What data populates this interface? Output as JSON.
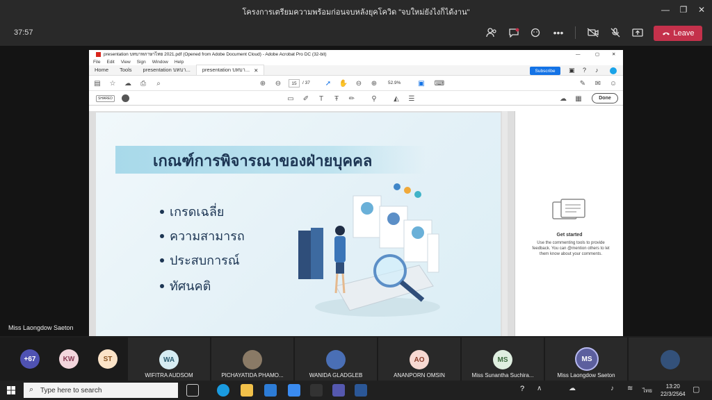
{
  "window": {
    "title": "โครงการเตรียมความพร้อมก่อนจบหลังยุคโควิด \"จบใหม่ยังไงก็ได้งาน\"",
    "minimize": "—",
    "maximize": "❐",
    "close": "✕"
  },
  "call": {
    "timer": "37:57",
    "leave_label": "Leave",
    "presenter_name": "Miss Laongdow Saeton"
  },
  "acrobat": {
    "title": "presentation บทบาทภาษาไทย 2021.pdf (Opened from Adobe Document Cloud) - Adobe Acrobat Pro DC (32-bit)",
    "menu": [
      "File",
      "Edit",
      "View",
      "Sign",
      "Window",
      "Help"
    ],
    "tabs": [
      "Home",
      "Tools",
      "presentation บทบา...",
      "presentation บทบา..."
    ],
    "subscribe_label": "Subscribe",
    "page_current": "15",
    "page_total": "/ 37",
    "zoom": "52.9%",
    "shared_label": "SHARED",
    "done_label": "Done",
    "side_panel": {
      "heading": "Get started",
      "text": "Use the commenting tools to provide feedback. You can @mention others to let them know about your comments."
    }
  },
  "slide": {
    "title": "เกณฑ์การพิจารณาของฝ่ายบุคคล",
    "bullets": [
      "เกรดเฉลี่ย",
      "ความสามารถ",
      "ประสบการณ์",
      "ทัศนคติ"
    ]
  },
  "participants": {
    "overflow": "+67",
    "tiles": [
      {
        "initials": "KW",
        "color": "#f3d6dd",
        "text_color": "#8a3c55"
      },
      {
        "initials": "ST",
        "color": "#fbe3c7",
        "text_color": "#8a5420"
      },
      {
        "initials": "WA",
        "name": "WIFITRA AUDSOM",
        "color": "#d6ecf2",
        "text_color": "#2b5c70"
      },
      {
        "name": "PICHAYATIDA PHAMO..."
      },
      {
        "name": "WANIDA GLADGLEB"
      },
      {
        "initials": "AO",
        "name": "ANANPORN OMSIN",
        "color": "#f7d9d2",
        "text_color": "#8a3c2a"
      },
      {
        "initials": "MS",
        "name": "Miss Sunantha Suchira...",
        "color": "#dfeee0",
        "text_color": "#3c6a3e"
      },
      {
        "initials": "MS",
        "name": "Miss Laongdow Saeton",
        "color": "#5c5f9e",
        "text_color": "#ffffff"
      }
    ]
  },
  "taskbar": {
    "search_placeholder": "Type here to search",
    "lang": "ไทย",
    "time": "13:20",
    "date": "22/3/2564"
  }
}
